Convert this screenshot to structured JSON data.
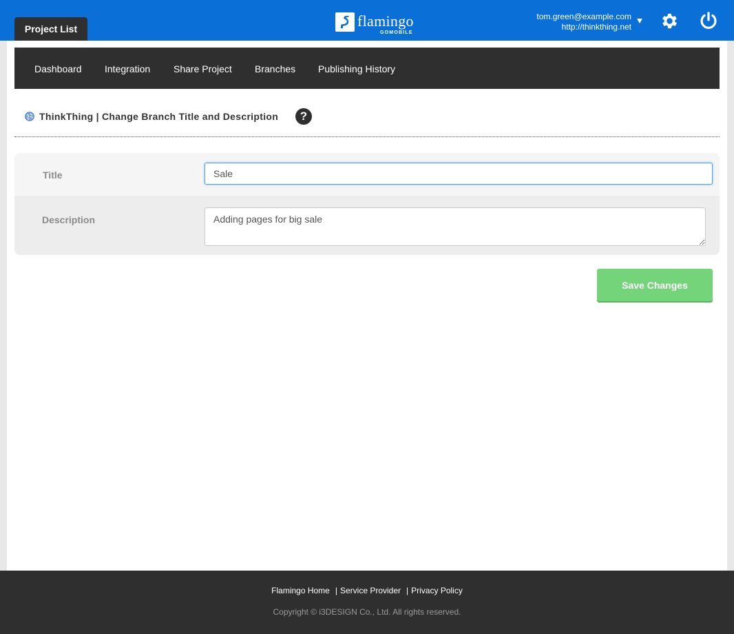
{
  "header": {
    "project_tab_label": "Project List",
    "logo_text": "flamingo",
    "logo_subtext": "GOMOBILE",
    "account_email": "tom.green@example.com",
    "account_url": "http://thinkthing.net",
    "accent_color": "#0a6fd6"
  },
  "nav": {
    "items": [
      {
        "label": "Dashboard"
      },
      {
        "label": "Integration"
      },
      {
        "label": "Share Project"
      },
      {
        "label": "Branches"
      },
      {
        "label": "Publishing History"
      }
    ]
  },
  "page": {
    "title": "ThinkThing | Change Branch Title and Description",
    "help_label": "?"
  },
  "form": {
    "title_label": "Title",
    "title_value": "Sale",
    "description_label": "Description",
    "description_value": "Adding pages for big sale",
    "save_label": "Save Changes",
    "save_color": "#74d47a"
  },
  "footer": {
    "links": [
      {
        "label": "Flamingo Home"
      },
      {
        "label": "Service Provider"
      },
      {
        "label": "Privacy Policy"
      }
    ],
    "copyright": "Copyright © i3DESIGN Co., Ltd. All rights reserved."
  }
}
